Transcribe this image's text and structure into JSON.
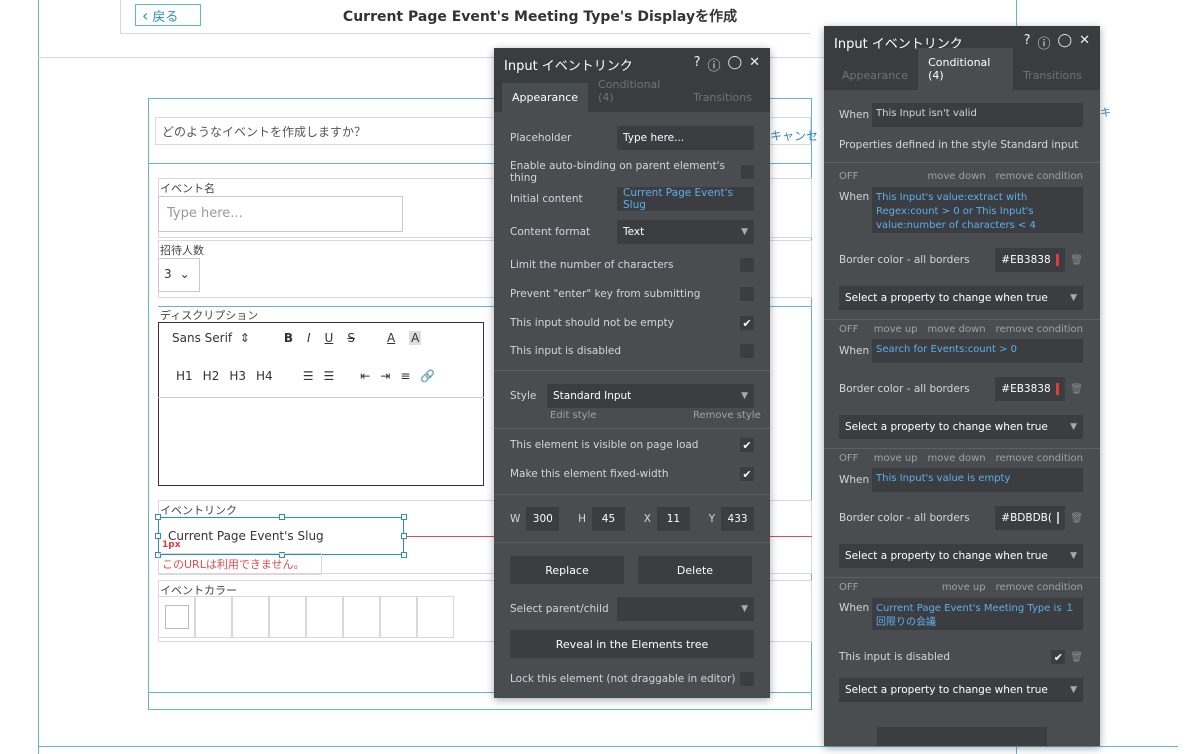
{
  "app": {
    "back_label": "戻る",
    "page_title": "Current Page Event's Meeting Type's Displayを作成"
  },
  "canvas": {
    "question_input": "どのようなイベントを作成しますか？",
    "cancel_label": "キャンセ",
    "cancel_label_2": "キ",
    "event_name_label": "イベント名",
    "event_name_placeholder": "Type here...",
    "guest_label": "招待人数",
    "guest_value": "3",
    "description_label": "ディスクリプション",
    "editor": {
      "font": "Sans Serif",
      "bold": "B",
      "italic": "I",
      "underline": "U",
      "strike": "S",
      "color": "A",
      "bg": "A",
      "h1": "H1",
      "h2": "H2",
      "h3": "H3",
      "h4": "H4"
    },
    "event_link_label": "イベントリンク",
    "event_link_value": "Current Page Event's Slug",
    "px_badge": "1px",
    "error_text": "このURLは利用できません。",
    "event_color_label": "イベントカラー"
  },
  "property_editor": {
    "title": "Input イベントリンク",
    "tabs": [
      {
        "label": "Appearance",
        "active": true
      },
      {
        "label": "Conditional (4)",
        "active": false
      },
      {
        "label": "Transitions",
        "active": false
      }
    ],
    "placeholder_label": "Placeholder",
    "placeholder_value": "Type here...",
    "autobind_label": "Enable auto-binding on parent element's thing",
    "initial_content_label": "Initial content",
    "initial_content_value": "Current Page Event's Slug",
    "content_format_label": "Content format",
    "content_format_value": "Text",
    "limit_chars_label": "Limit the number of characters",
    "prevent_enter_label": "Prevent \"enter\" key from submitting",
    "not_empty_label": "This input should not be empty",
    "disabled_label": "This input is disabled",
    "style_label": "Style",
    "style_value": "Standard Input",
    "edit_style": "Edit style",
    "remove_style": "Remove style",
    "visible_label": "This element is visible on page load",
    "fixed_width_label": "Make this element fixed-width",
    "w_label": "W",
    "w_value": "300",
    "h_label": "H",
    "h_value": "45",
    "x_label": "X",
    "x_value": "11",
    "y_label": "Y",
    "y_value": "433",
    "replace_label": "Replace",
    "delete_label": "Delete",
    "select_parent_label": "Select parent/child",
    "reveal_label": "Reveal in the Elements tree",
    "lock_label": "Lock this element (not draggable in editor)"
  },
  "conditional_panel": {
    "title": "Input イベントリンク",
    "tabs": [
      {
        "label": "Appearance",
        "active": false
      },
      {
        "label": "Conditional (4)",
        "active": true
      },
      {
        "label": "Transitions",
        "active": false
      }
    ],
    "when_label": "When",
    "first_when": "This Input isn't valid",
    "style_note": "Properties defined in the style Standard input",
    "off_label": "OFF",
    "move_down": "move down",
    "move_up": "move up",
    "remove_condition": "remove condition",
    "cond1_expr": "This Input's value:extract with Regex:count > 0 or This Input's value:number of characters < 4",
    "cond2_expr": "Search for Events:count > 0",
    "cond3_expr": "This Input's value is empty",
    "cond4_expr": "Current Page Event's Meeting Type is １回限りの会議",
    "border_color_label": "Border color - all borders",
    "color1": "#EB3838",
    "color2": "#EB3838",
    "color3": "#BDBDB(",
    "select_property": "Select a property to change when true",
    "input_disabled_label": "This input is disabled",
    "colors": {
      "red": "#e23b3b",
      "gray": "#bdbdbd"
    }
  }
}
